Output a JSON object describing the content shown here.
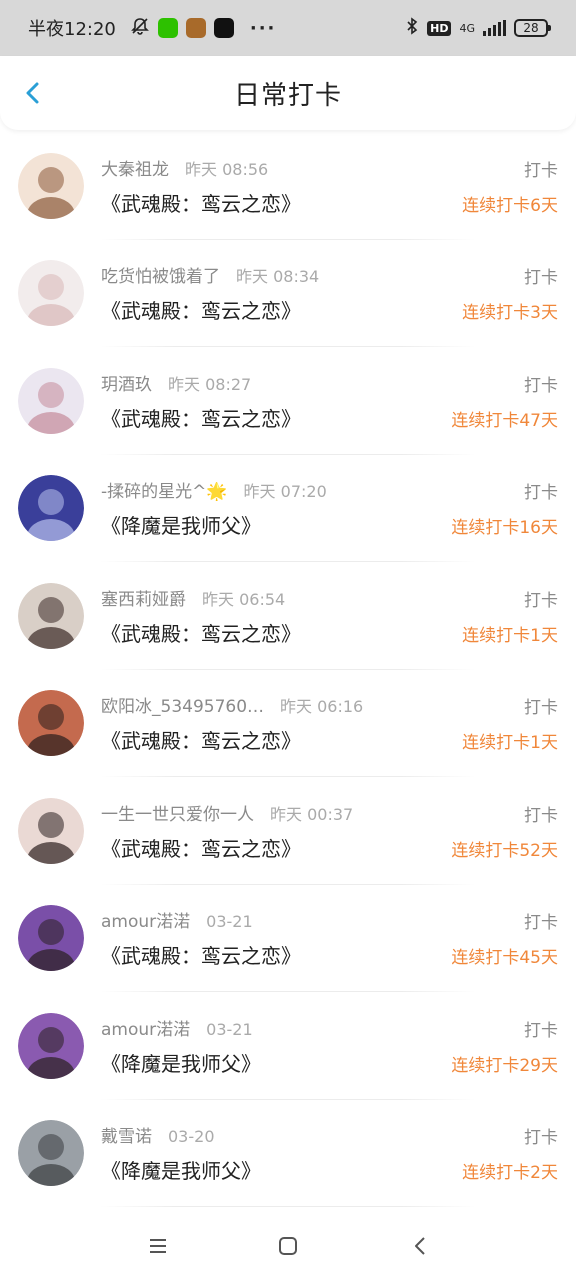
{
  "status_bar": {
    "time": "半夜12:20",
    "network": "4G",
    "battery": "28"
  },
  "header": {
    "title": "日常打卡",
    "accent": "#2a9fd6"
  },
  "list": [
    {
      "name": "大秦祖龙",
      "time": "昨天 08:56",
      "book": "《武魂殿：鸾云之恋》",
      "label": "打卡",
      "streak": "连续打卡6天",
      "avatar_colors": [
        "#f3e3d6",
        "#8a5a3a"
      ]
    },
    {
      "name": "吃货怕被饿着了",
      "time": "昨天 08:34",
      "book": "《武魂殿：鸾云之恋》",
      "label": "打卡",
      "streak": "连续打卡3天",
      "avatar_colors": [
        "#f2ecec",
        "#d9b8b8"
      ]
    },
    {
      "name": "玥酒玖",
      "time": "昨天 08:27",
      "book": "《武魂殿：鸾云之恋》",
      "label": "打卡",
      "streak": "连续打卡47天",
      "avatar_colors": [
        "#ebe6f0",
        "#c48a9a"
      ]
    },
    {
      "name": "-揉碎的星光^🌟",
      "time": "昨天 07:20",
      "book": "《降魔是我师父》",
      "label": "打卡",
      "streak": "连续打卡16天",
      "avatar_colors": [
        "#3a3f9a",
        "#b9c2ee"
      ]
    },
    {
      "name": "塞西莉娅爵",
      "time": "昨天 06:54",
      "book": "《武魂殿：鸾云之恋》",
      "label": "打卡",
      "streak": "连续打卡1天",
      "avatar_colors": [
        "#d9cfc7",
        "#3a2a26"
      ]
    },
    {
      "name": "欧阳冰_53495760…",
      "time": "昨天 06:16",
      "book": "《武魂殿：鸾云之恋》",
      "label": "打卡",
      "streak": "连续打卡1天",
      "avatar_colors": [
        "#c46a4e",
        "#2a1e1c"
      ]
    },
    {
      "name": "一生一世只爱你一人",
      "time": "昨天 00:37",
      "book": "《武魂殿：鸾云之恋》",
      "label": "打卡",
      "streak": "连续打卡52天",
      "avatar_colors": [
        "#ead9d4",
        "#2c2020"
      ]
    },
    {
      "name": "amour渃渃",
      "time": "03-21",
      "book": "《武魂殿：鸾云之恋》",
      "label": "打卡",
      "streak": "连续打卡45天",
      "avatar_colors": [
        "#7a4fa8",
        "#2a2020"
      ]
    },
    {
      "name": "amour渃渃",
      "time": "03-21",
      "book": "《降魔是我师父》",
      "label": "打卡",
      "streak": "连续打卡29天",
      "avatar_colors": [
        "#8a5ab0",
        "#2a2020"
      ]
    },
    {
      "name": "戴雪诺",
      "time": "03-20",
      "book": "《降魔是我师父》",
      "label": "打卡",
      "streak": "连续打卡2天",
      "avatar_colors": [
        "#9aa0a6",
        "#3a3d40"
      ]
    }
  ],
  "nav": {
    "icons": [
      "menu-icon",
      "home-square-icon",
      "back-triangle-icon"
    ]
  }
}
